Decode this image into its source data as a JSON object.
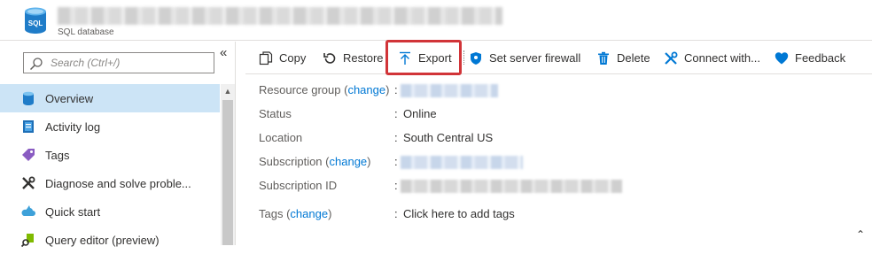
{
  "header": {
    "resource_type": "SQL database",
    "db_icon_text": "SQL",
    "icon": "sql-database-icon"
  },
  "sidebar": {
    "search_placeholder": "Search (Ctrl+/)",
    "collapse_glyph": "«",
    "items": [
      {
        "label": "Overview",
        "icon": "sql-database-icon",
        "active": true
      },
      {
        "label": "Activity log",
        "icon": "activity-log-icon",
        "active": false
      },
      {
        "label": "Tags",
        "icon": "tag-icon",
        "active": false
      },
      {
        "label": "Diagnose and solve proble...",
        "icon": "wrench-icon",
        "active": false
      },
      {
        "label": "Quick start",
        "icon": "cloud-icon",
        "active": false
      },
      {
        "label": "Query editor (preview)",
        "icon": "query-editor-icon",
        "active": false
      }
    ]
  },
  "toolbar": {
    "copy": "Copy",
    "restore": "Restore",
    "export": "Export",
    "set_server_firewall": "Set server firewall",
    "delete": "Delete",
    "connect_with": "Connect with...",
    "feedback": "Feedback"
  },
  "properties": {
    "resource_group": {
      "label": "Resource group",
      "link": "change"
    },
    "status": {
      "label": "Status",
      "value": "Online"
    },
    "location": {
      "label": "Location",
      "value": "South Central US"
    },
    "subscription": {
      "label": "Subscription",
      "link": "change"
    },
    "subscription_id": {
      "label": "Subscription ID"
    },
    "tags": {
      "label": "Tags",
      "link": "change",
      "value": "Click here to add tags"
    },
    "colon": ":"
  },
  "colors": {
    "accent": "#0078d4",
    "highlight": "#d13438",
    "active_nav": "#cce4f6"
  }
}
